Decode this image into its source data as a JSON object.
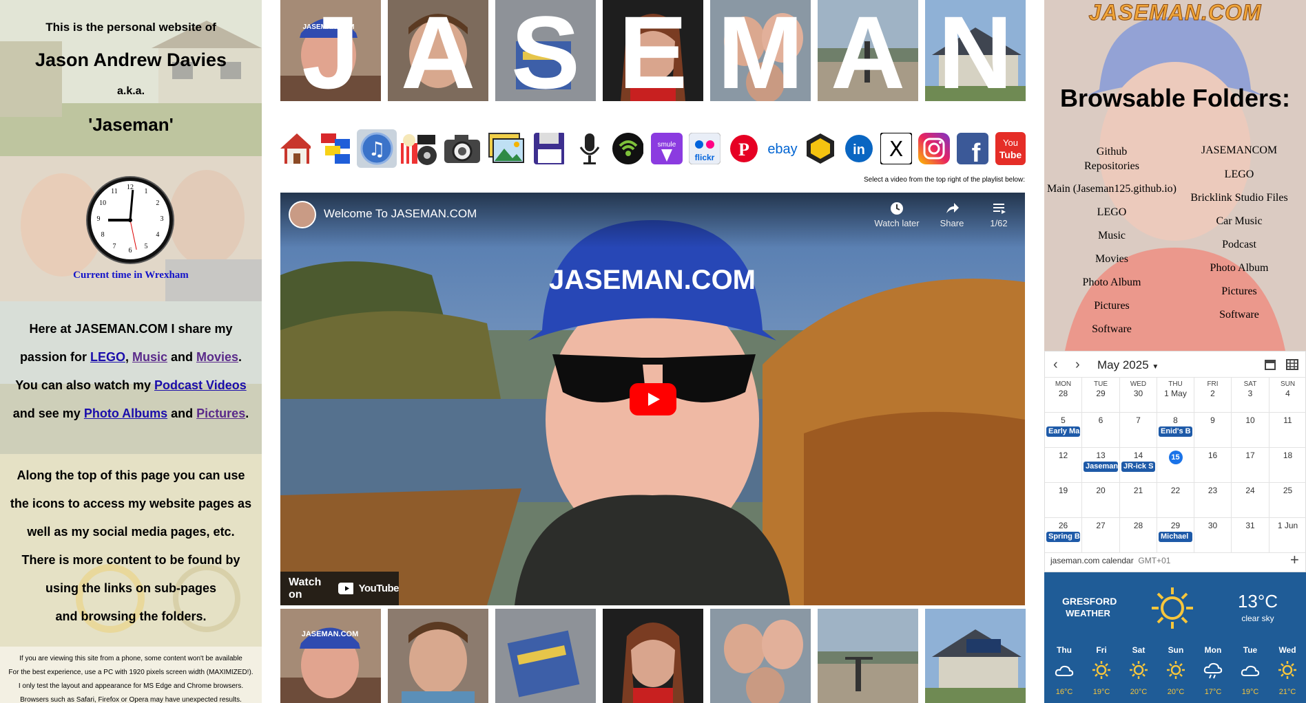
{
  "left": {
    "intro_line1": "This is the personal website of",
    "intro_name": "Jason Andrew Davies",
    "intro_aka": "a.k.a.",
    "intro_nick": "'Jaseman'",
    "clock_caption": "Current time in Wrexham",
    "clock_numbers": [
      "12",
      "1",
      "2",
      "3",
      "4",
      "5",
      "6",
      "7",
      "8",
      "9",
      "10",
      "11"
    ],
    "para1": {
      "t1": "Here at JASEMAN.COM I share my",
      "t2a": "passion for ",
      "lego": "LEGO",
      "sep1": ", ",
      "music": "Music",
      "and1": " and ",
      "movies": "Movies",
      "dot1": ".",
      "t3a": "You can also watch my ",
      "podcast": "Podcast Videos",
      "t4a": "and see my ",
      "photo": "Photo Albums",
      "and2": " and ",
      "pictures": "Pictures",
      "dot2": "."
    },
    "para2": [
      "Along the top of this page you can use",
      "the icons to access my website pages as",
      "well as my social media pages, etc.",
      "There is more content to be found by",
      "using the links on sub-pages",
      "and browsing the folders."
    ],
    "fine": [
      "If you are viewing this site from a phone, some content won't be available",
      "For the best experience, use a PC with 1920 pixels screen width (MAXIMIZED!).",
      "I only test the layout and appearance for MS Edge and Chrome browsers.",
      "Browsers such as Safari, Firefox or Opera may have unexpected results."
    ]
  },
  "banner_letters": [
    "J",
    "A",
    "S",
    "E",
    "M",
    "A",
    "N"
  ],
  "icons": [
    "home-icon",
    "lego-bricks-icon",
    "music-note-icon",
    "movies-icon",
    "camera-icon",
    "photo-album-icon",
    "floppy-disk-icon",
    "microphone-icon",
    "podcast-icon",
    "smule-icon",
    "flickr-icon",
    "pinterest-icon",
    "ebay-icon",
    "bricklink-icon",
    "linkedin-icon",
    "x-icon",
    "instagram-icon",
    "facebook-icon",
    "youtube-icon"
  ],
  "icon_text": {
    "flickr": "flickr",
    "ebay": "ebay",
    "youtube_you": "You",
    "youtube_tube": "Tube",
    "smule": "smule",
    "linkedin": "in",
    "x": "X",
    "facebook": "f",
    "pinterest": "P"
  },
  "video": {
    "hint": "Select a video from the top right of the playlist below:",
    "title": "Welcome To JASEMAN.COM",
    "watch_later": "Watch later",
    "share": "Share",
    "playlist_count": "1/62",
    "watch_on": "Watch on",
    "youtube": "YouTube",
    "cap_text": "JASEMAN.COM"
  },
  "right": {
    "logo": "JASEMAN.COM",
    "cap_text": "JASEMAN.COM",
    "heading": "Browsable Folders:",
    "col1": [
      "Github",
      "Repositories",
      "Main (Jaseman125.github.io)",
      "LEGO",
      "Music",
      "Movies",
      "Photo Album",
      "Pictures",
      "Software"
    ],
    "col2": [
      "JASEMANCOM",
      "LEGO",
      "Bricklink Studio Files",
      "Car Music",
      "Podcast",
      "Photo Album",
      "Pictures",
      "Software"
    ]
  },
  "calendar": {
    "month": "May 2025",
    "prev": "‹",
    "next": "›",
    "days": [
      "MON",
      "TUE",
      "WED",
      "THU",
      "FRI",
      "SAT",
      "SUN"
    ],
    "weeks": [
      [
        "28",
        "29",
        "30",
        "1 May",
        "2",
        "3",
        "4"
      ],
      [
        "5",
        "6",
        "7",
        "8",
        "9",
        "10",
        "11"
      ],
      [
        "12",
        "13",
        "14",
        "15",
        "16",
        "17",
        "18"
      ],
      [
        "19",
        "20",
        "21",
        "22",
        "23",
        "24",
        "25"
      ],
      [
        "26",
        "27",
        "28",
        "29",
        "30",
        "31",
        "1 Jun"
      ]
    ],
    "events": [
      {
        "week": 1,
        "day": 0,
        "text": "Early Ma"
      },
      {
        "week": 1,
        "day": 3,
        "text": "Enid's B"
      },
      {
        "week": 2,
        "day": 1,
        "text": "Jaseman"
      },
      {
        "week": 2,
        "day": 2,
        "text": "JR-ick S"
      },
      {
        "week": 4,
        "day": 0,
        "text": "Spring B"
      },
      {
        "week": 4,
        "day": 3,
        "text": "Michael"
      }
    ],
    "today": "15",
    "footer": "jaseman.com calendar",
    "tz": "GMT+01",
    "plus": "+"
  },
  "weather": {
    "place": "GRESFORD",
    "label": "WEATHER",
    "temp": "13°C",
    "desc": "clear sky",
    "days": [
      {
        "d": "Thu",
        "icon": "cloud-icon",
        "t": "16°C"
      },
      {
        "d": "Fri",
        "icon": "sun-icon",
        "t": "19°C"
      },
      {
        "d": "Sat",
        "icon": "sun-icon",
        "t": "20°C"
      },
      {
        "d": "Sun",
        "icon": "sun-icon",
        "t": "20°C"
      },
      {
        "d": "Mon",
        "icon": "rain-cloud-icon",
        "t": "17°C"
      },
      {
        "d": "Tue",
        "icon": "cloud-icon",
        "t": "19°C"
      },
      {
        "d": "Wed",
        "icon": "sun-icon",
        "t": "21°C"
      }
    ]
  }
}
